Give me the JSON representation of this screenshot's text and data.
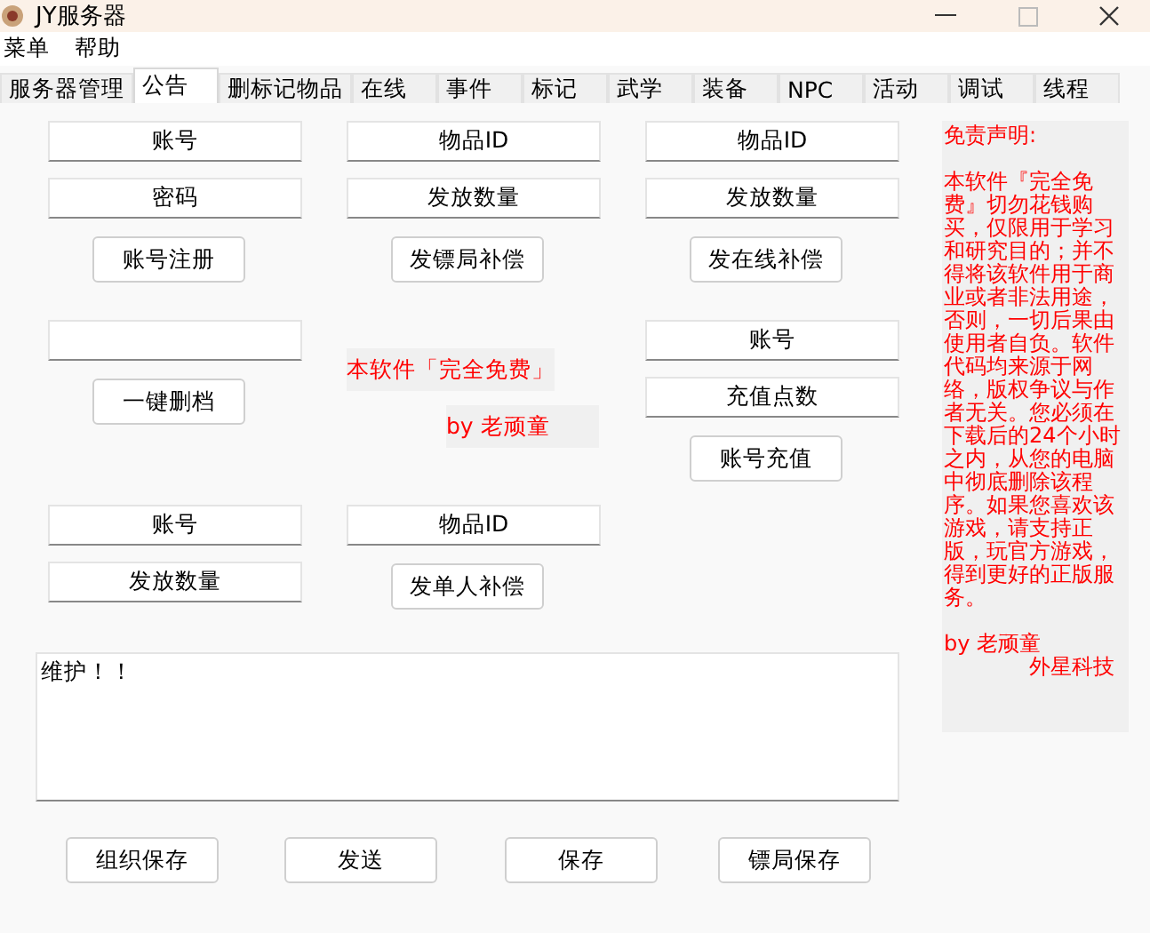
{
  "window": {
    "title": "JY服务器"
  },
  "menu": [
    "菜单",
    "帮助"
  ],
  "tabs": [
    {
      "label": "服务器管理",
      "selected": false
    },
    {
      "label": "公告",
      "selected": true
    },
    {
      "label": "删标记物品",
      "selected": false
    },
    {
      "label": "在线",
      "selected": false
    },
    {
      "label": "事件",
      "selected": false
    },
    {
      "label": "标记",
      "selected": false
    },
    {
      "label": "武学",
      "selected": false
    },
    {
      "label": "装备",
      "selected": false
    },
    {
      "label": "NPC",
      "selected": false
    },
    {
      "label": "活动",
      "selected": false
    },
    {
      "label": "调试",
      "selected": false
    },
    {
      "label": "线程",
      "selected": false
    }
  ],
  "columns": [
    {
      "items": [
        {
          "kind": "field",
          "value": "账号"
        },
        {
          "kind": "field",
          "value": "密码"
        },
        {
          "kind": "button",
          "label": "账号注册"
        },
        {
          "kind": "field",
          "value": ""
        },
        {
          "kind": "button",
          "label": "一键删档"
        },
        {
          "kind": "field",
          "value": "账号"
        },
        {
          "kind": "field",
          "value": "发放数量"
        }
      ]
    },
    {
      "items": [
        {
          "kind": "field",
          "value": "物品ID"
        },
        {
          "kind": "field",
          "value": "发放数量"
        },
        {
          "kind": "button",
          "label": "发镖局补偿"
        },
        {
          "kind": "note",
          "text": "本软件「完全免费」"
        },
        {
          "kind": "note",
          "text": "by 老顽童"
        },
        {
          "kind": "field",
          "value": "物品ID"
        },
        {
          "kind": "button",
          "label": "发单人补偿"
        }
      ]
    },
    {
      "items": [
        {
          "kind": "field",
          "value": "物品ID"
        },
        {
          "kind": "field",
          "value": "发放数量"
        },
        {
          "kind": "button",
          "label": "发在线补偿"
        },
        {
          "kind": "field",
          "value": "账号"
        },
        {
          "kind": "field",
          "value": "充值点数"
        },
        {
          "kind": "button",
          "label": "账号充值"
        }
      ]
    }
  ],
  "notice": {
    "value": "维护！！"
  },
  "bottom_buttons": [
    "组织保存",
    "发送",
    "保存",
    "镖局保存"
  ],
  "disclaimer": {
    "title": "免责声明:",
    "body": "本软件『完全免费』切勿花钱购买，仅限用于学习和研究目的；并不得将该软件用于商业或者非法用途，否则，一切后果由使用者自负。软件代码均来源于网络，版权争议与作者无关。您必须在下载后的24个小时之内，从您的电脑中彻底删除该程序。如果您喜欢该游戏，请支持正版，玩官方游戏，得到更好的正版服务。",
    "author": "by 老顽童",
    "company": "外星科技"
  }
}
